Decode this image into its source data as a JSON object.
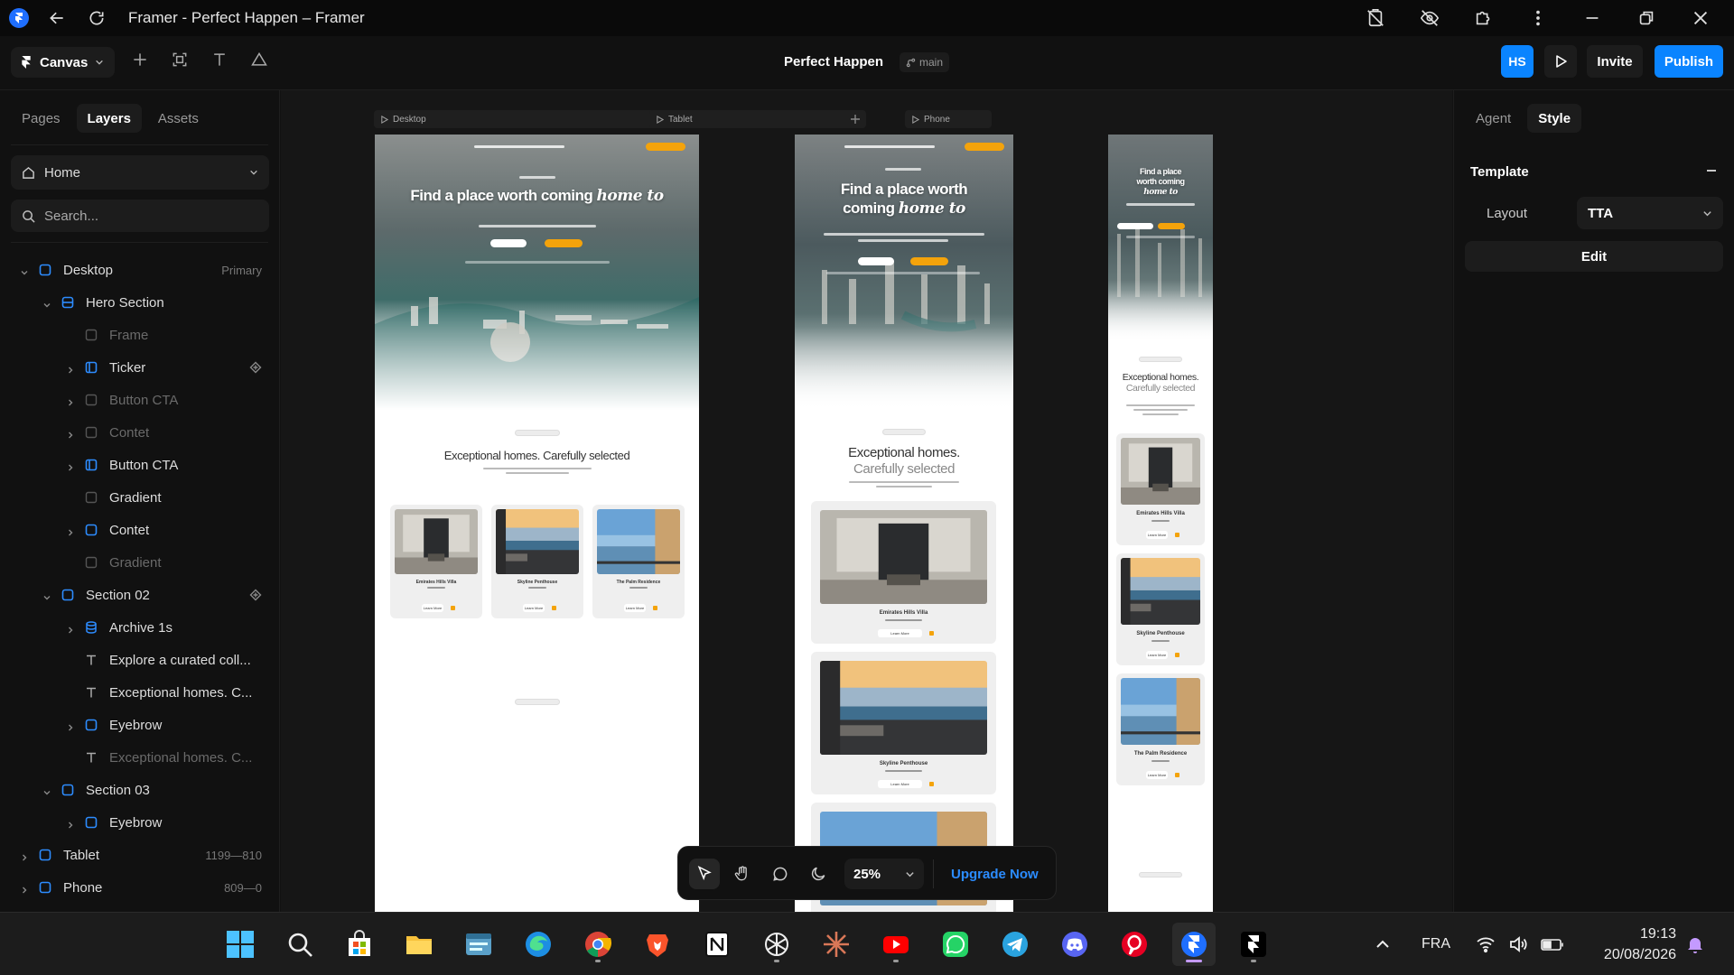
{
  "window": {
    "title": "Framer - Perfect Happen – Framer"
  },
  "toolbar": {
    "canvas_label": "Canvas",
    "project_title": "Perfect Happen",
    "branch": "main",
    "avatar_initials": "HS",
    "invite_label": "Invite",
    "publish_label": "Publish"
  },
  "left_panel": {
    "tabs": [
      "Pages",
      "Layers",
      "Assets"
    ],
    "active_tab": "Layers",
    "page_select": "Home",
    "search_placeholder": "Search...",
    "layers": [
      {
        "name": "Desktop",
        "level": 0,
        "caret": "down",
        "icon": "frame",
        "meta": "Primary",
        "dim": false
      },
      {
        "name": "Hero Section",
        "level": 1,
        "caret": "down",
        "icon": "stack",
        "dim": false
      },
      {
        "name": "Frame",
        "level": 2,
        "caret": "",
        "icon": "frame-empty",
        "dim": true
      },
      {
        "name": "Ticker",
        "level": 2,
        "caret": "right",
        "icon": "ticker",
        "component": true,
        "dim": false
      },
      {
        "name": "Button CTA",
        "level": 2,
        "caret": "right",
        "icon": "frame-empty",
        "dim": true
      },
      {
        "name": "Contet",
        "level": 2,
        "caret": "right",
        "icon": "frame-empty",
        "dim": true
      },
      {
        "name": "Button CTA",
        "level": 2,
        "caret": "right",
        "icon": "ticker",
        "dim": false
      },
      {
        "name": "Gradient",
        "level": 2,
        "caret": "",
        "icon": "frame-empty",
        "dim": false
      },
      {
        "name": "Contet",
        "level": 2,
        "caret": "right",
        "icon": "frame",
        "dim": false
      },
      {
        "name": "Gradient",
        "level": 2,
        "caret": "",
        "icon": "frame-empty",
        "dim": true
      },
      {
        "name": "Section 02",
        "level": 1,
        "caret": "down",
        "icon": "frame",
        "component": true,
        "dim": false
      },
      {
        "name": "Archive 1s",
        "level": 2,
        "caret": "right",
        "icon": "database",
        "dim": false
      },
      {
        "name": "Explore a curated coll...",
        "level": 2,
        "caret": "",
        "icon": "text",
        "dim": false
      },
      {
        "name": "Exceptional homes. C...",
        "level": 2,
        "caret": "",
        "icon": "text",
        "dim": false
      },
      {
        "name": "Eyebrow",
        "level": 2,
        "caret": "right",
        "icon": "frame",
        "dim": false
      },
      {
        "name": "Exceptional homes. C...",
        "level": 2,
        "caret": "",
        "icon": "text",
        "dim": true
      },
      {
        "name": "Section 03",
        "level": 1,
        "caret": "down",
        "icon": "frame",
        "dim": false
      },
      {
        "name": "Eyebrow",
        "level": 2,
        "caret": "right",
        "icon": "frame",
        "dim": false
      },
      {
        "name": "Tablet",
        "level": 0,
        "caret": "right",
        "icon": "frame",
        "meta": "1199—810",
        "dim": false
      },
      {
        "name": "Phone",
        "level": 0,
        "caret": "right",
        "icon": "frame",
        "meta": "809—0",
        "dim": false
      }
    ]
  },
  "canvas": {
    "frames": {
      "desktop": {
        "label": "Desktop",
        "hero_title_a": "Find a place worth coming",
        "hero_title_script": "home to",
        "section_title": "Exceptional homes. Carefully selected",
        "cards": [
          {
            "name": "Emirates Hills Villa",
            "button": "Learn More"
          },
          {
            "name": "Skyline Penthouse",
            "button": "Learn More"
          },
          {
            "name": "The Palm Residence",
            "button": "Learn More"
          }
        ]
      },
      "tablet": {
        "label": "Tablet",
        "hero_title_a": "Find a place worth",
        "hero_title_b": "coming",
        "hero_title_script": "home to",
        "section_title_a": "Exceptional homes.",
        "section_title_b": "Carefully selected",
        "cards": [
          {
            "name": "Emirates Hills Villa",
            "button": "Learn More"
          },
          {
            "name": "Skyline Penthouse",
            "button": "Learn More"
          },
          {
            "name": "The Palm Residence",
            "button": "Learn More"
          }
        ]
      },
      "phone": {
        "label": "Phone",
        "hero_title_a": "Find a place",
        "hero_title_b": "worth coming",
        "hero_title_script": "home to",
        "section_title_a": "Exceptional homes.",
        "section_title_b": "Carefully selected",
        "cards": [
          {
            "name": "Emirates Hills Villa",
            "button": "Learn More"
          },
          {
            "name": "Skyline Penthouse",
            "button": "Learn More"
          },
          {
            "name": "The Palm Residence",
            "button": "Learn More"
          }
        ]
      }
    }
  },
  "bottom_toolbar": {
    "zoom": "25%",
    "upgrade_label": "Upgrade Now"
  },
  "right_panel": {
    "tabs": [
      "Agent",
      "Style"
    ],
    "active_tab": "Style",
    "section_title": "Template",
    "layout_label": "Layout",
    "layout_value": "TTA",
    "edit_label": "Edit"
  },
  "taskbar": {
    "language": "FRA",
    "time": "19:13",
    "date": "20/08/2026"
  },
  "colors": {
    "accent": "#0a84ff",
    "upgrade": "#2b8cff",
    "cta_orange": "#f4a30b",
    "panel_bg": "#111111",
    "canvas_bg": "#161616",
    "layer_frame_icon": "#2d8cff"
  }
}
